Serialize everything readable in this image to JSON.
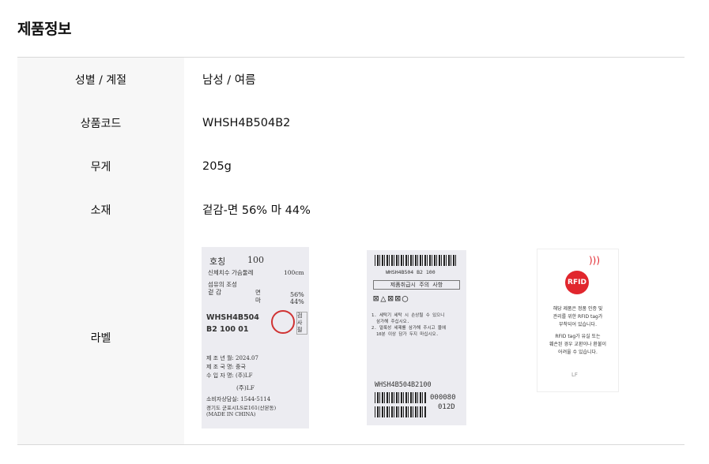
{
  "section_title": "제품정보",
  "rows": [
    {
      "label": "성별 / 계절",
      "value": "남성 / 여름"
    },
    {
      "label": "상품코드",
      "value": "WHSH4B504B2"
    },
    {
      "label": "무게",
      "value": "205g"
    },
    {
      "label": "소재",
      "value": "겉감-면 56% 마 44%"
    }
  ],
  "label_row_title": "라벨",
  "care_label_1": {
    "size_heading": "호칭",
    "size_value": "100",
    "chest_label": "신체치수 가슴둘레",
    "chest_value": "100cm",
    "fiber_label": "섬유의 조성",
    "outer_label": "겉 감",
    "cotton_label": "면",
    "cotton_pct": "56%",
    "linen_label": "마",
    "linen_pct": "44%",
    "code_line1": "WHSH4B504",
    "code_line2": "B2 100 01",
    "inspect_text": "검사필",
    "made_date": "제 조 년 월: 2024.07",
    "origin": "제 조 국 명: 중국",
    "importer": "수 입 자 명: (주)LF",
    "brand": "(주)LF",
    "consult": "소비자상담실: 1544-5114",
    "address": "경기도 군포시LS로161(산본동)",
    "made_in": "(MADE IN CHINA)"
  },
  "care_label_2": {
    "top_code": "WHSH4B504 B2 100",
    "care_heading": "제품취급시 주의 사항",
    "note1": "1. 세탁기 세탁 시 손상될 수 있으니",
    "note1b": "삼가해 주십시오.",
    "note2": "2. 얼룩성 세제를 삼가해 주시고 물에",
    "note2b": "10분 이상 담가 두지 마십시오.",
    "bottom_code": "WHSH4B504B2100",
    "serial1": "000080",
    "serial2": "012D"
  },
  "rfid_label": {
    "badge": "RFID",
    "text1": "해당 제품은 정품 인증 및",
    "text2": "관리를 위한 RFID tag가",
    "text3": "부착되어 있습니다.",
    "text4": "RFID tag가 유실 또는",
    "text5": "훼손된 경우 교환이나 환불이",
    "text6": "어려울 수 있습니다.",
    "logo": "LF",
    "accent_color": "#e1262d"
  }
}
